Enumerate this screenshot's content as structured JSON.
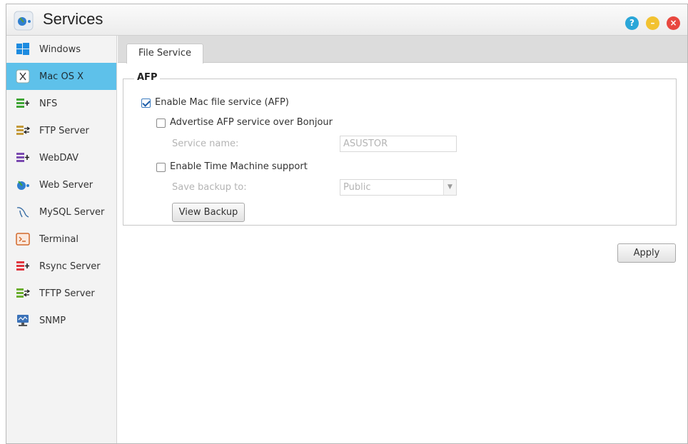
{
  "window": {
    "title": "Services",
    "help_glyph": "?",
    "minimize_glyph": "–",
    "close_glyph": "×"
  },
  "sidebar": {
    "items": [
      {
        "label": "Windows",
        "icon": "windows-icon",
        "active": false
      },
      {
        "label": "Mac OS X",
        "icon": "mac-os-x-icon",
        "active": true
      },
      {
        "label": "NFS",
        "icon": "nfs-icon",
        "active": false
      },
      {
        "label": "FTP Server",
        "icon": "ftp-server-icon",
        "active": false
      },
      {
        "label": "WebDAV",
        "icon": "webdav-icon",
        "active": false
      },
      {
        "label": "Web Server",
        "icon": "web-server-icon",
        "active": false
      },
      {
        "label": "MySQL Server",
        "icon": "mysql-server-icon",
        "active": false
      },
      {
        "label": "Terminal",
        "icon": "terminal-icon",
        "active": false
      },
      {
        "label": "Rsync Server",
        "icon": "rsync-server-icon",
        "active": false
      },
      {
        "label": "TFTP Server",
        "icon": "tftp-server-icon",
        "active": false
      },
      {
        "label": "SNMP",
        "icon": "snmp-icon",
        "active": false
      }
    ]
  },
  "tabs": [
    {
      "label": "File Service",
      "active": true
    }
  ],
  "afp": {
    "legend": "AFP",
    "enable_label": "Enable Mac file service (AFP)",
    "enable_checked": true,
    "bonjour_label": "Advertise AFP service over Bonjour",
    "bonjour_checked": false,
    "service_name_label": "Service name:",
    "service_name_value": "ASUSTOR",
    "time_machine_label": "Enable Time Machine support",
    "time_machine_checked": false,
    "save_backup_label": "Save backup to:",
    "save_backup_value": "Public",
    "view_backup_label": "View Backup"
  },
  "actions": {
    "apply_label": "Apply"
  },
  "colors": {
    "active_item": "#5ec1ea",
    "help": "#2aa6d8",
    "minimize": "#f2c230",
    "close": "#e8473f"
  }
}
